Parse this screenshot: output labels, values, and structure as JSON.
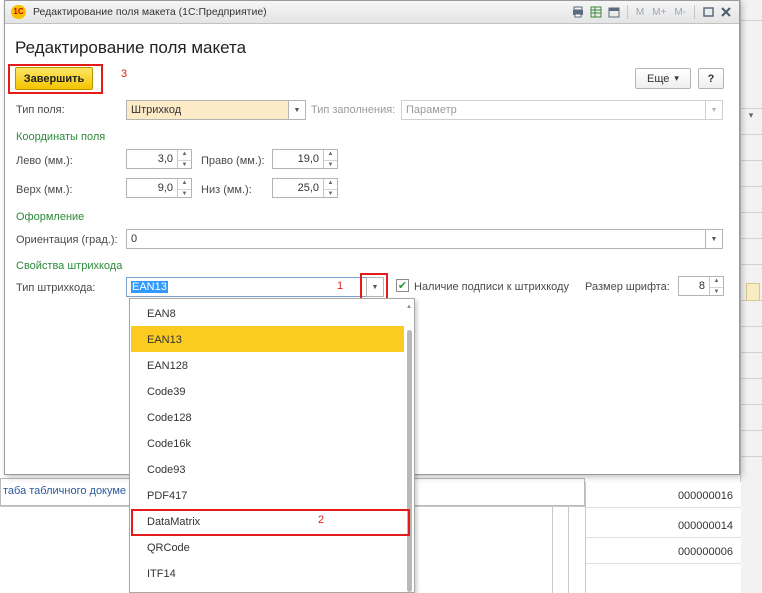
{
  "window": {
    "title": "Редактирование поля макета (1С:Предприятие)",
    "logo": "1С",
    "toolbar_m": [
      "M",
      "M+",
      "M-"
    ]
  },
  "page_title": "Редактирование поля макета",
  "buttons": {
    "finish": "Завершить",
    "more": "Еще",
    "more_arrow": "▾",
    "help": "?"
  },
  "annotations": [
    "1",
    "2",
    "3"
  ],
  "field_type": {
    "label": "Тип поля:",
    "value": "Штрихкод",
    "fill_label": "Тип заполнения:",
    "fill_value": "Параметр"
  },
  "coordinates": {
    "group_title": "Координаты поля",
    "left_label": "Лево (мм.):",
    "left_value": "3,0",
    "right_label": "Право (мм.):",
    "right_value": "19,0",
    "top_label": "Верх (мм.):",
    "top_value": "9,0",
    "bottom_label": "Низ (мм.):",
    "bottom_value": "25,0"
  },
  "design": {
    "group_title": "Оформление",
    "orientation_label": "Ориентация (град.):",
    "orientation_value": "0"
  },
  "barcode": {
    "group_title": "Свойства штрихкода",
    "type_label": "Тип штрихкода:",
    "type_value": "EAN13",
    "caption_checkbox_label": "Наличие подписи к штрихкоду",
    "caption_checked": true,
    "check_mark": "✔",
    "font_size_label": "Размер шрифта:",
    "font_size_value": "8"
  },
  "dropdown": {
    "items": [
      "EAN8",
      "EAN13",
      "EAN128",
      "Code39",
      "Code128",
      "Code16k",
      "Code93",
      "PDF417",
      "DataMatrix",
      "QRCode",
      "ITF14"
    ],
    "selected": "EAN13"
  },
  "background": {
    "left_text": "таба табличного докуме",
    "numbers": [
      "000000016",
      "000000014",
      "000000006"
    ]
  },
  "colors": {
    "accent_yellow": "#f4c400",
    "highlight_row": "#fbcb1f",
    "annotation_red": "#e31b1b",
    "group_green": "#2d8a3a",
    "selection_blue": "#3399ff"
  }
}
